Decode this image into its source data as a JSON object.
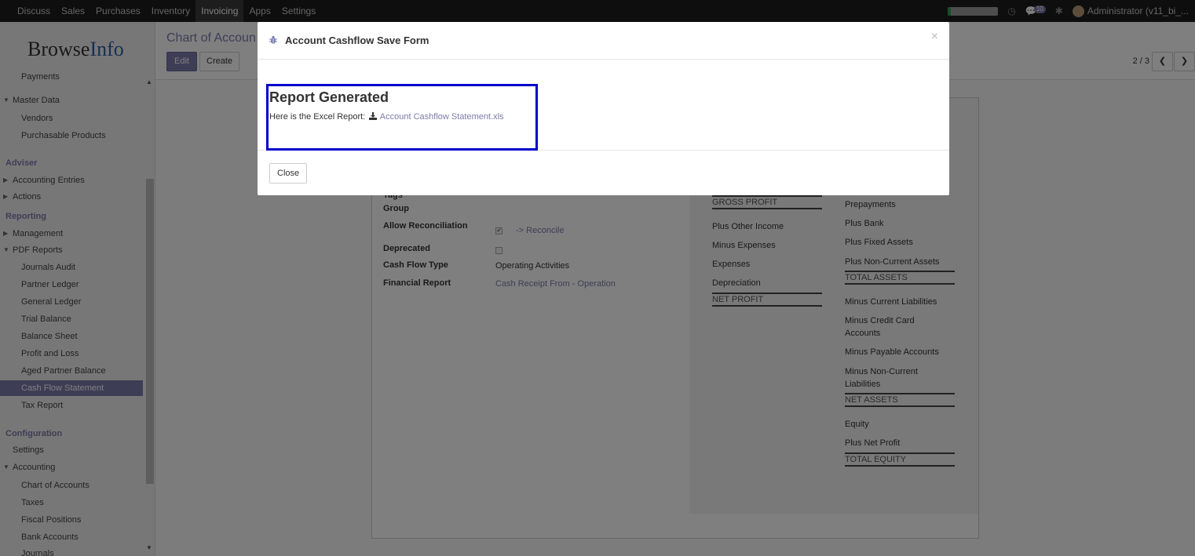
{
  "navbar": {
    "menu": [
      "Discuss",
      "Sales",
      "Purchases",
      "Inventory",
      "Invoicing",
      "Apps",
      "Settings"
    ],
    "active": "Invoicing",
    "progress": 0.05,
    "badge_count": "10",
    "user": "Administrator (v11_bi_..."
  },
  "sidebar": {
    "logo_main": "Browse",
    "logo_accent": "Info",
    "items": [
      {
        "label": "Payments",
        "type": "sub"
      },
      {
        "label": "Master Data",
        "type": "parent",
        "caret": "▼"
      },
      {
        "label": "Vendors",
        "type": "sub"
      },
      {
        "label": "Purchasable Products",
        "type": "sub"
      },
      {
        "label": "Adviser",
        "type": "section"
      },
      {
        "label": "Accounting Entries",
        "type": "parent",
        "caret": "▶"
      },
      {
        "label": "Actions",
        "type": "parent",
        "caret": "▶"
      },
      {
        "label": "Reporting",
        "type": "section"
      },
      {
        "label": "Management",
        "type": "parent",
        "caret": "▶"
      },
      {
        "label": "PDF Reports",
        "type": "parent",
        "caret": "▼"
      },
      {
        "label": "Journals Audit",
        "type": "sub"
      },
      {
        "label": "Partner Ledger",
        "type": "sub"
      },
      {
        "label": "General Ledger",
        "type": "sub"
      },
      {
        "label": "Trial Balance",
        "type": "sub"
      },
      {
        "label": "Balance Sheet",
        "type": "sub"
      },
      {
        "label": "Profit and Loss",
        "type": "sub"
      },
      {
        "label": "Aged Partner Balance",
        "type": "sub"
      },
      {
        "label": "Cash Flow Statement",
        "type": "sub",
        "active": true
      },
      {
        "label": "Tax Report",
        "type": "sub"
      },
      {
        "label": "Configuration",
        "type": "section"
      },
      {
        "label": "Settings",
        "type": "parent"
      },
      {
        "label": "Accounting",
        "type": "parent",
        "caret": "▼"
      },
      {
        "label": "Chart of Accounts",
        "type": "sub"
      },
      {
        "label": "Taxes",
        "type": "sub"
      },
      {
        "label": "Fiscal Positions",
        "type": "sub"
      },
      {
        "label": "Bank Accounts",
        "type": "sub"
      },
      {
        "label": "Journals",
        "type": "sub"
      }
    ]
  },
  "control_panel": {
    "breadcrumb": "Chart of Accoun",
    "edit_label": "Edit",
    "create_label": "Create",
    "pager": "2 / 3"
  },
  "form": {
    "fields": {
      "tags_label": "Tags",
      "group_label": "Group",
      "allow_reconciliation_label": "Allow Reconciliation",
      "reconcile_link": "-> Reconcile",
      "deprecated_label": "Deprecated",
      "cash_flow_type_label": "Cash Flow Type",
      "cash_flow_type_value": "Operating Activities",
      "financial_report_label": "Financial Report",
      "financial_report_value": "Cash Receipt From - Operation"
    },
    "pl_column": {
      "gross_profit": "GROSS PROFIT",
      "items": [
        "Plus Other Income",
        "Minus Expenses",
        "Expenses",
        "Depreciation"
      ],
      "net_profit": "NET PROFIT"
    },
    "bs_column": {
      "prepayments": "Prepayments",
      "plus_bank": "Plus Bank",
      "plus_fixed_assets": "Plus Fixed Assets",
      "plus_non_current_assets": "Plus Non-Current Assets",
      "total_assets": "TOTAL ASSETS",
      "minus_current_liabilities": "Minus Current Liabilities",
      "minus_credit_card_1": "Minus Credit Card",
      "minus_credit_card_2": "Accounts",
      "minus_payable_accounts": "Minus Payable Accounts",
      "minus_non_current_1": "Minus Non-Current",
      "minus_non_current_2": "Liabilities",
      "net_assets": "NET ASSETS",
      "equity": "Equity",
      "plus_net_profit": "Plus Net Profit",
      "total_equity": "TOTAL EQUITY"
    }
  },
  "modal": {
    "title": "Account Cashflow Save Form",
    "close_symbol": "×",
    "report_title": "Report Generated",
    "report_prefix": "Here is the Excel Report:",
    "report_link": "Account Cashflow Statement.xls",
    "close_button": "Close"
  },
  "colors": {
    "accent": "#7c7bad",
    "highlight_border": "#0000cc",
    "navbar_bg": "#1d1d1d"
  }
}
